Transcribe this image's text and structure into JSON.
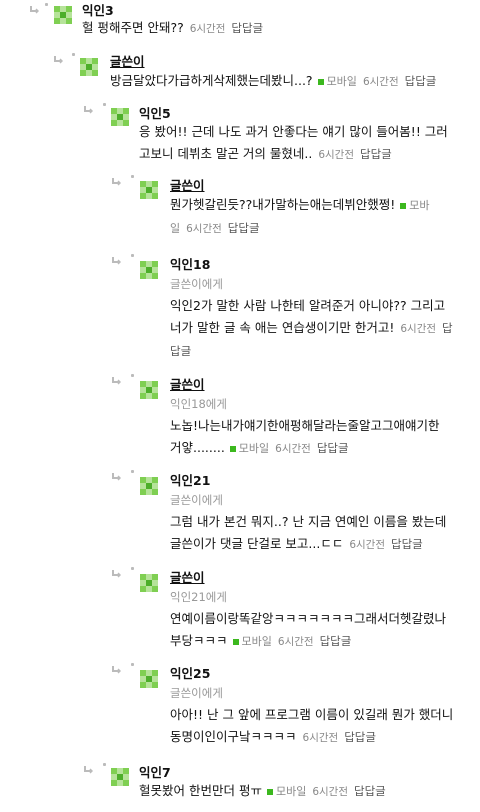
{
  "comments": [
    {
      "nick": "익인3",
      "to": "",
      "text": "헐 펑해주면 안돼??",
      "mobile": "",
      "time": "6시간전",
      "reply": "답답글"
    },
    {
      "nick": "글쓴이",
      "to": "",
      "text": "방금달았다가급하게삭제했는데봤니...?",
      "mobile": "모바일",
      "time": "6시간전",
      "reply": "답답글"
    },
    {
      "nick": "익인5",
      "to": "",
      "text1": "응 봤어!! 근데 나도 과거 안좋다는 얘기 많이 들어봄!! 그러",
      "text2": "고보니 데뷔초 말곤 거의 물혔네..",
      "mobile": "",
      "time": "6시간전",
      "reply": "답답글"
    },
    {
      "nick": "글쓴이",
      "to": "",
      "text1": "뭔가헷갈린듯??내가말하는애는데뷔안했쩡!",
      "mobile1": "모바",
      "text2": "일",
      "time": "6시간전",
      "reply": "답답글"
    },
    {
      "nick": "익인18",
      "to": "글쓴이에게",
      "text1": "익인2가 말한 사람 나한테 알려준거 아니야?? 그리고",
      "text2": "너가 말한 글 속 애는 연습생이기만 한거고!",
      "time": "6시간전",
      "reply1": "답",
      "reply2": "답글"
    },
    {
      "nick": "글쓴이",
      "to": "익인18에게",
      "text1": "노놉!나는내가얘기한애펑해달라는줄알고그애얘기한",
      "text2": "거얗........",
      "mobile": "모바일",
      "time": "6시간전",
      "reply": "답답글"
    },
    {
      "nick": "익인21",
      "to": "글쓴이에게",
      "text1": "그럼 내가 본건 뭐지..? 난 지금 연예인 이름을 봤는데",
      "text2": "글쓴이가 댓글 단걸로 보고...ㄷㄷ",
      "time": "6시간전",
      "reply": "답답글"
    },
    {
      "nick": "글쓴이",
      "to": "익인21에게",
      "text1": "연예이름이랑똑같앙ㅋㅋㅋㅋㅋㅋㅋ그래서더헷갈렸나",
      "text2": "부당ㅋㅋㅋ",
      "mobile": "모바일",
      "time": "6시간전",
      "reply": "답답글"
    },
    {
      "nick": "익인25",
      "to": "글쓴이에게",
      "text1": "아아!! 난 그 앞에 프로그램 이름이 있길래 뭔가 했더니",
      "text2": "동명이인이구낰ㅋㅋㅋㅋ",
      "time": "6시간전",
      "reply": "답답글"
    },
    {
      "nick": "익인7",
      "to": "",
      "text": "헐못봤어 한번만더 펑ㅠ",
      "mobile": "모바일",
      "time": "6시간전",
      "reply": "답답글"
    }
  ],
  "colors": {
    "mobile": "#3cb81e",
    "avatar_light": "#b6e39a",
    "avatar_mid": "#7fcf52",
    "avatar_dark": "#4cae2a"
  },
  "icons": {
    "reply_arrow": "reply-arrow-icon",
    "avatar": "avatar-icon",
    "mobile": "mobile-badge-icon"
  }
}
